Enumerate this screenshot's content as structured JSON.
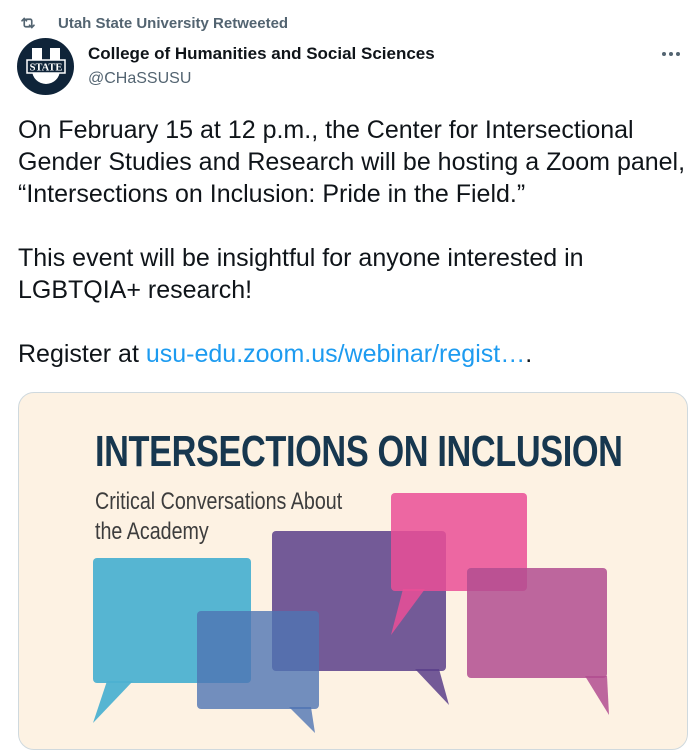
{
  "retweet": {
    "label": "Utah State University Retweeted",
    "icon": "retweet-icon"
  },
  "author": {
    "name": "College of Humanities and Social Sciences",
    "handle": "@CHaSSUSU",
    "avatar_text": "STATE",
    "avatar_color": "#0f2439"
  },
  "more_icon": "ellipsis-icon",
  "tweet": {
    "paragraph1": "On February 15 at 12 p.m., the Center for Intersectional Gender Studies and Research will be hosting a Zoom panel, “Intersections on Inclusion: Pride in the Field.”",
    "paragraph2": "This event will be insightful for anyone interested in LGBTQIA+ research!",
    "register_prefix": "Register at ",
    "register_link": "usu-edu.zoom.us/webinar/regist…",
    "register_suffix": "."
  },
  "media": {
    "title": "INTERSECTIONS ON INCLUSION",
    "subtitle_line1": "Critical Conversations About",
    "subtitle_line2": "the Academy",
    "background": "#fdf2e3",
    "colors": {
      "cyan": "#4db1d1",
      "blue": "#4f74b3",
      "purple": "#6a5291",
      "pink": "#ea4f97",
      "magenta": "#b24d90"
    }
  },
  "colors": {
    "link": "#1d9bf0",
    "muted": "#536471",
    "text": "#0f1419"
  }
}
